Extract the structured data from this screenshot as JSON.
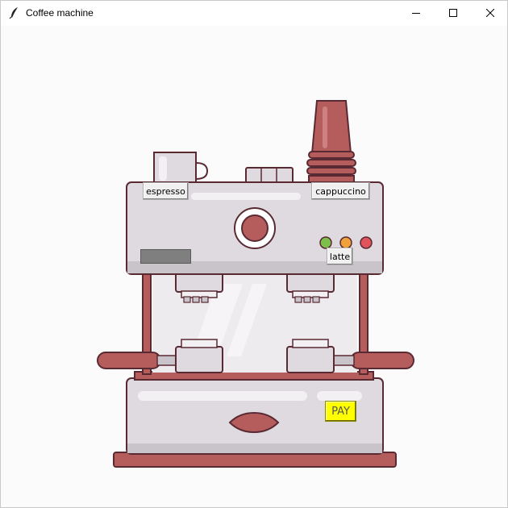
{
  "window": {
    "title": "Coffee machine",
    "icon": "feather-icon",
    "controls": {
      "minimize": "minimize-icon",
      "maximize": "maximize-icon",
      "close": "close-icon"
    }
  },
  "buttons": {
    "espresso_label": "espresso",
    "cappuccino_label": "cappuccino",
    "latte_label": "latte",
    "pay_label": "PAY"
  },
  "display": {
    "value": ""
  },
  "colors": {
    "machine_red": "#b55d5d",
    "machine_outline": "#5a2a33",
    "body_light": "#dedadf",
    "body_shade": "#c9c3ca",
    "pay_yellow": "#ffff00",
    "indicator_green": "#7dbf4a",
    "indicator_orange": "#f0a23a",
    "indicator_red": "#e0535b"
  }
}
